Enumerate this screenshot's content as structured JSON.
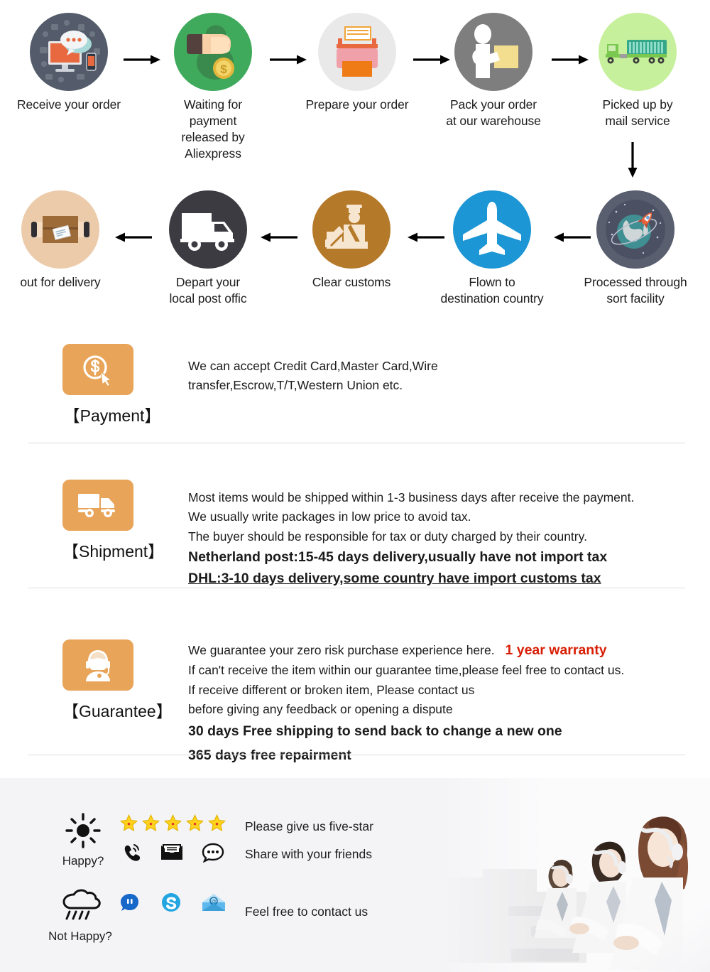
{
  "flow": {
    "row1": [
      {
        "label": "Receive your order",
        "icon": "order-received-icon",
        "circle_color": "#545c6b"
      },
      {
        "label": "Waiting for payment\nreleased by Aliexpress",
        "icon": "money-hand-icon",
        "circle_color": "#3faa5c"
      },
      {
        "label": "Prepare your order",
        "icon": "printer-icon",
        "circle_color": "#e9e9ea"
      },
      {
        "label": "Pack your order\nat our warehouse",
        "icon": "packing-worker-icon",
        "circle_color": "#7e7e7e"
      },
      {
        "label": "Picked up by\nmail service",
        "icon": "mail-truck-icon",
        "circle_color": "#c6f09b"
      }
    ],
    "row2": [
      {
        "label": "out for delivery",
        "icon": "parcel-scan-icon",
        "circle_color": "#eccbab"
      },
      {
        "label": "Depart your\nlocal post offic",
        "icon": "delivery-van-icon",
        "circle_color": "#3b3b41"
      },
      {
        "label": "Clear customs",
        "icon": "customs-officer-icon",
        "circle_color": "#b5792a"
      },
      {
        "label": "Flown to\ndestination country",
        "icon": "airplane-icon",
        "circle_color": "#1c96d4"
      },
      {
        "label": "Processed through\nsort facility",
        "icon": "globe-rocket-icon",
        "circle_color": "#5a5f70"
      }
    ],
    "arrow_color": "#000000"
  },
  "sections": [
    {
      "key": "payment",
      "badge_label": "【Payment】",
      "icon": "coin-cursor-icon",
      "lines": [
        {
          "text": "We can accept Credit Card,Master Card,Wire",
          "style": "normal"
        },
        {
          "text": "transfer,Escrow,T/T,Western Union etc.",
          "style": "normal"
        }
      ]
    },
    {
      "key": "shipment",
      "badge_label": "【Shipment】",
      "icon": "truck-icon",
      "lines": [
        {
          "text": "Most items would be shipped within 1-3 business days after receive the payment.",
          "style": "normal"
        },
        {
          "text": "We usually write packages in low price to avoid tax.",
          "style": "normal"
        },
        {
          "text": "The buyer should be responsible for tax or duty charged by their country.",
          "style": "normal"
        },
        {
          "text": "Netherland post:15-45 days delivery,usually have not import tax",
          "style": "bold"
        },
        {
          "text": "DHL:3-10 days delivery,some country have import customs tax",
          "style": "bold-underline"
        }
      ]
    },
    {
      "key": "guarantee",
      "badge_label": "【Guarantee】",
      "icon": "support-agent-icon",
      "lines": [
        {
          "text": "We guarantee your zero risk purchase experience here.",
          "style": "normal",
          "suffix": "1 year warranty",
          "suffix_style": "red-bold"
        },
        {
          "text": "If can't receive the item within our guarantee time,please feel free to contact us.",
          "style": "normal"
        },
        {
          "text": "If receive different or broken item, Please contact us",
          "style": "normal"
        },
        {
          "text": "before giving any feedback or opening a dispute",
          "style": "normal"
        },
        {
          "text": "30 days Free shipping to send back to change a new one",
          "style": "red"
        },
        {
          "text": "365 days free repairment",
          "style": "red"
        }
      ]
    }
  ],
  "feedback": {
    "happy": {
      "mood_label": "Happy?",
      "mood_icon": "sun-icon",
      "stars": 5,
      "star_color": "#ffd21e",
      "icons": [
        "phone-ring-icon",
        "email-icon",
        "chat-bubble-icon"
      ],
      "texts": [
        "Please give us five-star",
        "Share with your friends"
      ]
    },
    "not_happy": {
      "mood_label": "Not Happy?",
      "mood_icon": "rain-cloud-icon",
      "icons": [
        "aliwangwang-icon",
        "skype-icon",
        "mail-envelope-icon"
      ],
      "texts": [
        "Feel free to contact us"
      ]
    },
    "photo_alt": "call-center-agents-photo"
  },
  "colors": {
    "accent_orange": "#e8a458",
    "red": "#d81f06",
    "band_bg": "#f4f4f6",
    "divider": "#dcdcdc"
  }
}
